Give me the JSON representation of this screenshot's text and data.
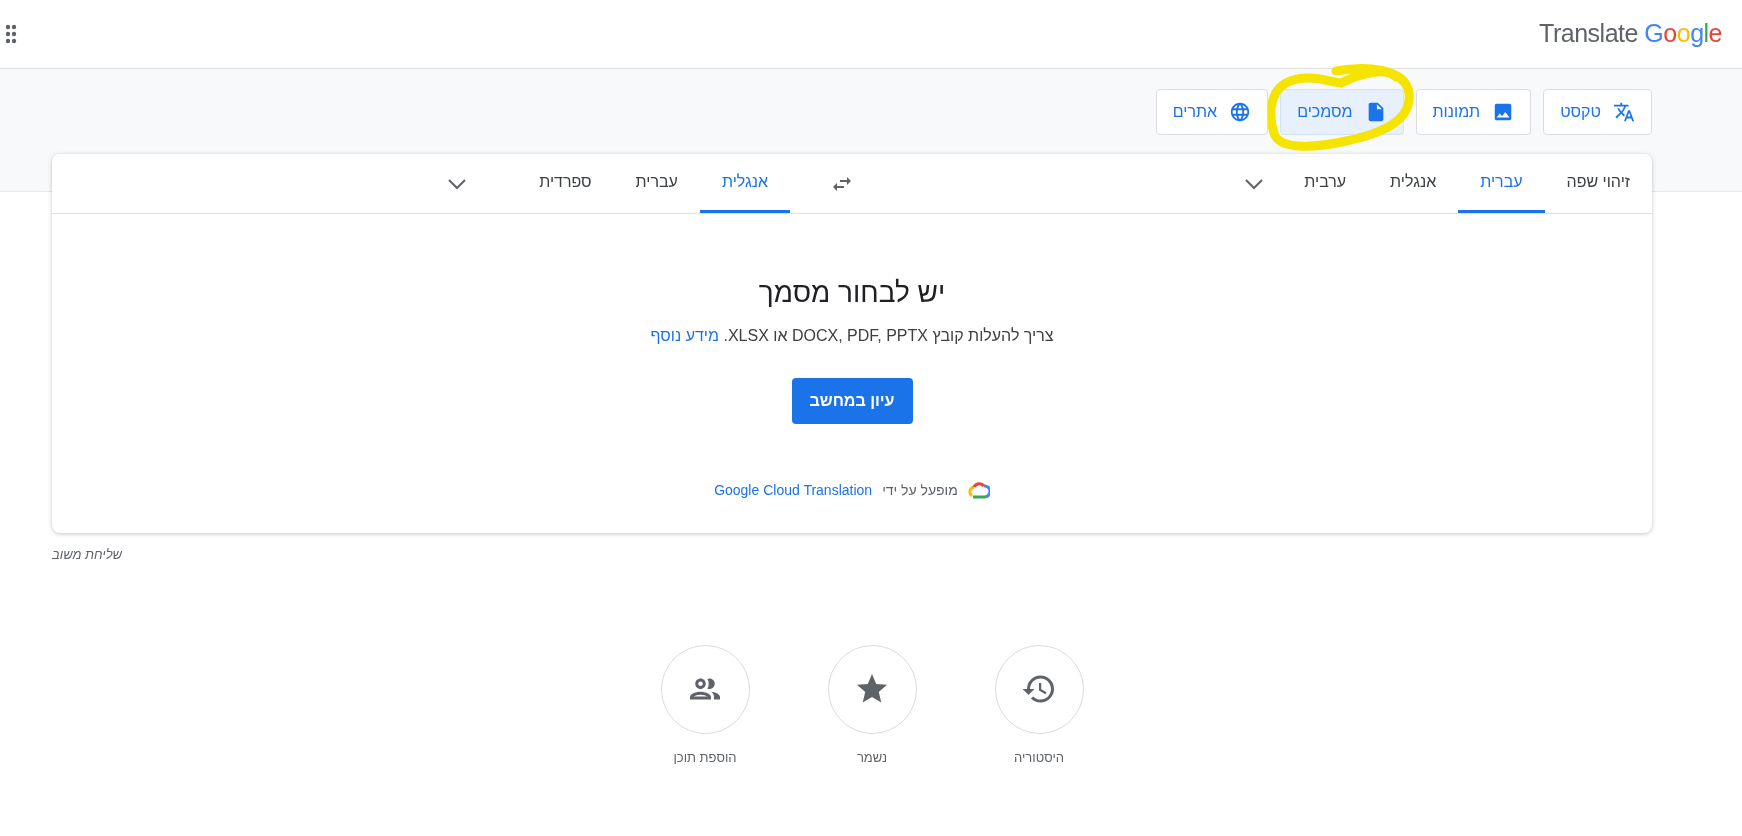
{
  "header": {
    "logo": {
      "product": "Translate",
      "brand": "Google"
    }
  },
  "modes": [
    {
      "label": "טקסט",
      "kind": "translate",
      "selected": false,
      "highlighted": false
    },
    {
      "label": "תמונות",
      "kind": "image",
      "selected": false,
      "highlighted": false
    },
    {
      "label": "מסמכים",
      "kind": "document",
      "selected": true,
      "highlighted": true
    },
    {
      "label": "אתרים",
      "kind": "globe",
      "selected": false,
      "highlighted": false
    }
  ],
  "source_languages": [
    {
      "label": "זיהוי שפה",
      "selected": false
    },
    {
      "label": "עברית",
      "selected": true
    },
    {
      "label": "אנגלית",
      "selected": false
    },
    {
      "label": "ערבית",
      "selected": false
    }
  ],
  "target_languages": [
    {
      "label": "אנגלית",
      "selected": true
    },
    {
      "label": "עברית",
      "selected": false
    },
    {
      "label": "ספרדית",
      "selected": false
    }
  ],
  "upload": {
    "title": "יש לבחור מסמך",
    "description": "צריך להעלות קובץ DOCX, PDF, PPTX או XLSX.",
    "learn_more": "מידע נוסף",
    "browse_button": "עיון במחשב",
    "powered_by": "מופעל על ידי",
    "powered_by_link": "Google Cloud Translation"
  },
  "feedback": "שליחת משוב",
  "actions": [
    {
      "label": "היסטוריה",
      "kind": "history"
    },
    {
      "label": "נשמר",
      "kind": "star"
    },
    {
      "label": "הוספת תוכן",
      "kind": "people"
    }
  ]
}
